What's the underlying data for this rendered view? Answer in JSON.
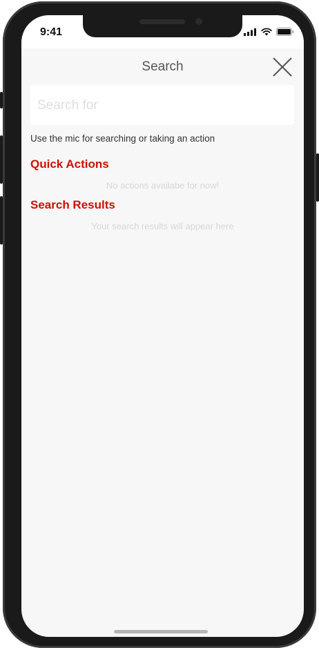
{
  "status_bar": {
    "time": "9:41",
    "icons": [
      "signal-bars-icon",
      "wifi-icon",
      "battery-icon"
    ]
  },
  "header": {
    "title": "Search",
    "close_icon": "close-icon"
  },
  "search": {
    "placeholder": "Search for",
    "value": "",
    "hint": "Use the mic for searching or taking an action"
  },
  "quick_actions": {
    "title": "Quick Actions",
    "empty_message": "No actions availabe for now!"
  },
  "search_results": {
    "title": "Search Results",
    "empty_message": "Your search results will appear here"
  },
  "colors": {
    "accent": "#cc1100",
    "background": "#f7f7f7",
    "muted_text": "#d7d7d7"
  }
}
